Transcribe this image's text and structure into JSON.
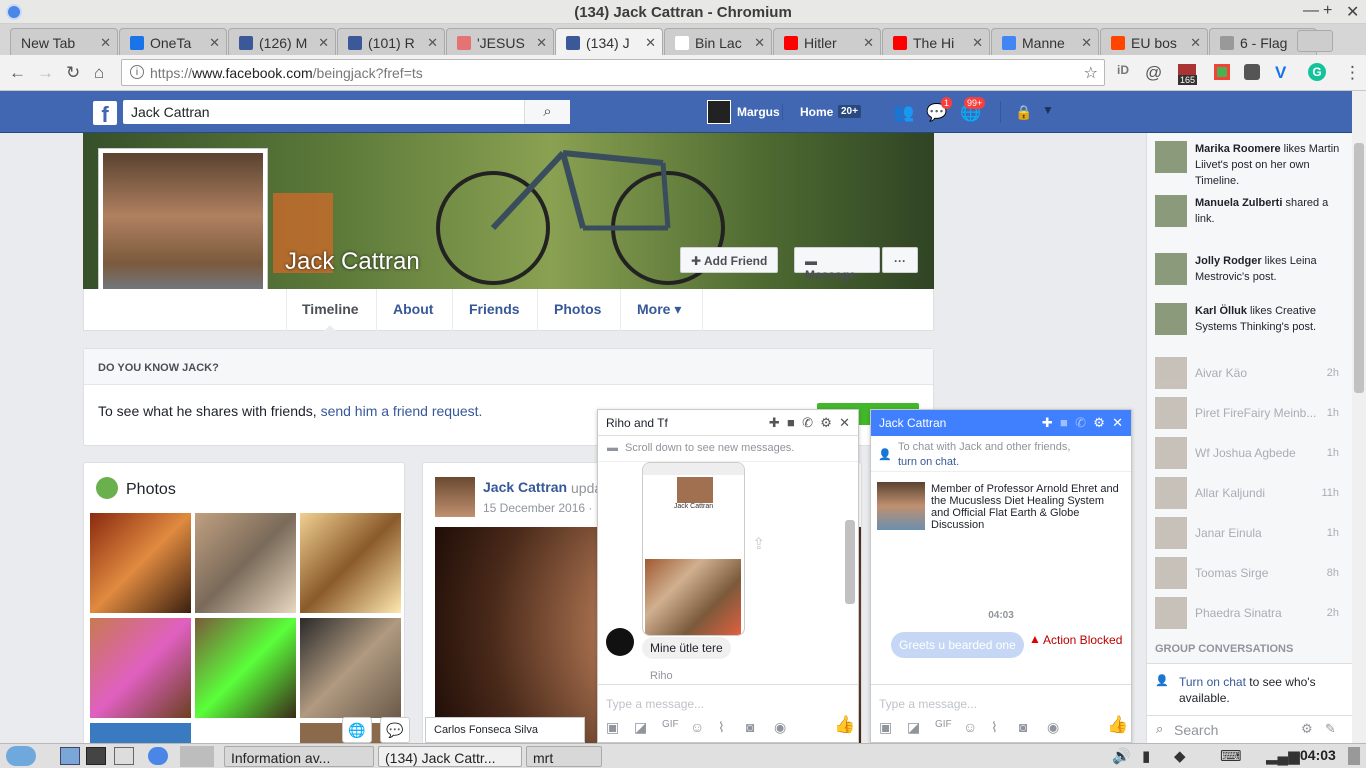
{
  "window": {
    "title": "(134) Jack Cattran - Chromium"
  },
  "tabs": [
    {
      "label": "New Tab",
      "color": "#cccccc"
    },
    {
      "label": "OneTa",
      "color": "#1a73e8"
    },
    {
      "label": "(126) M",
      "color": "#3b5998"
    },
    {
      "label": "(101) R",
      "color": "#3b5998"
    },
    {
      "label": "'JESUS",
      "color": "#e57373"
    },
    {
      "label": "(134) J",
      "color": "#3b5998"
    },
    {
      "label": "Bin Lac",
      "color": "#ffffff"
    },
    {
      "label": "Hitler",
      "color": "#ff0000"
    },
    {
      "label": "The Hi",
      "color": "#ff0000"
    },
    {
      "label": "Manne",
      "color": "#4285f4"
    },
    {
      "label": "EU bos",
      "color": "#ff4500"
    },
    {
      "label": "6 - Flag",
      "color": "#999999"
    }
  ],
  "address": {
    "scheme": "https://",
    "host": "www.facebook.com",
    "path": "/beingjack?fref=ts"
  },
  "ext_badge": "165",
  "fb": {
    "search_value": "Jack Cattran",
    "user_name": "Margus",
    "home_label": "Home",
    "home_count": "20+",
    "messages_badge": "1",
    "notifications_badge": "99+"
  },
  "profile": {
    "name": "Jack Cattran",
    "add_friend": "Add Friend",
    "message": "Message",
    "more_dots": "···",
    "nav": [
      "Timeline",
      "About",
      "Friends",
      "Photos",
      "More ▾"
    ]
  },
  "know": {
    "heading": "DO YOU KNOW JACK?",
    "text": "To see what he shares with friends, ",
    "link": "send him a friend request."
  },
  "photos": {
    "title": "Photos"
  },
  "post": {
    "author": "Jack Cattran",
    "action": "upda",
    "date": "15 December 2016 · "
  },
  "ticker": [
    {
      "name": "Marika Roomere",
      "text": " likes Martin Liivet's post on her own Timeline."
    },
    {
      "name": "Manuela Zulberti",
      "text": " shared a link."
    },
    {
      "name": "Jolly Rodger",
      "text": " likes Leina Mestrovic's post."
    },
    {
      "name": "Karl Ölluk",
      "text": " likes Creative Systems Thinking's post."
    }
  ],
  "contacts": [
    {
      "name": "Aivar Käo",
      "time": "2h"
    },
    {
      "name": "Piret FireFairy Meinb...",
      "time": "1h"
    },
    {
      "name": "Wf Joshua Agbede",
      "time": "1h"
    },
    {
      "name": "Allar Kaljundi",
      "time": "11h"
    },
    {
      "name": "Janar Einula",
      "time": "1h"
    },
    {
      "name": "Toomas Sirge",
      "time": "8h"
    },
    {
      "name": "Phaedra Sinatra",
      "time": "2h"
    }
  ],
  "group_conversations": "GROUP CONVERSATIONS",
  "turn_on_chat": {
    "link": "Turn on chat",
    "text": " to see who's available."
  },
  "sidebar_search": "Search",
  "chat1": {
    "title": "Riho and Tf",
    "notice": "Scroll down to see new messages.",
    "message": "Mine ütle tere",
    "sender": "Riho",
    "placeholder": "Type a message...",
    "shot_name": "Jack Cattran"
  },
  "chat2": {
    "title": "Jack Cattran",
    "notice_text": "To chat with Jack and other friends,",
    "notice_link": "turn on chat.",
    "bio": "Member of Professor Arnold Ehret and the Mucusless Diet Healing System and Official Flat Earth & Globe Discussion",
    "time": "04:03",
    "bubble": "Greets u bearded one",
    "blocked": "Action Blocked",
    "placeholder": "Type a message..."
  },
  "hover_tooltip": "Carlos Fonseca Silva",
  "taskbar": {
    "items": [
      "Information av...",
      "(134) Jack Cattr...",
      "mrt"
    ],
    "clock": "04:03"
  },
  "colors": {
    "fb_blue": "#4267b2",
    "link": "#365899",
    "badge": "#fa3e3e",
    "green": "#42b72a"
  }
}
